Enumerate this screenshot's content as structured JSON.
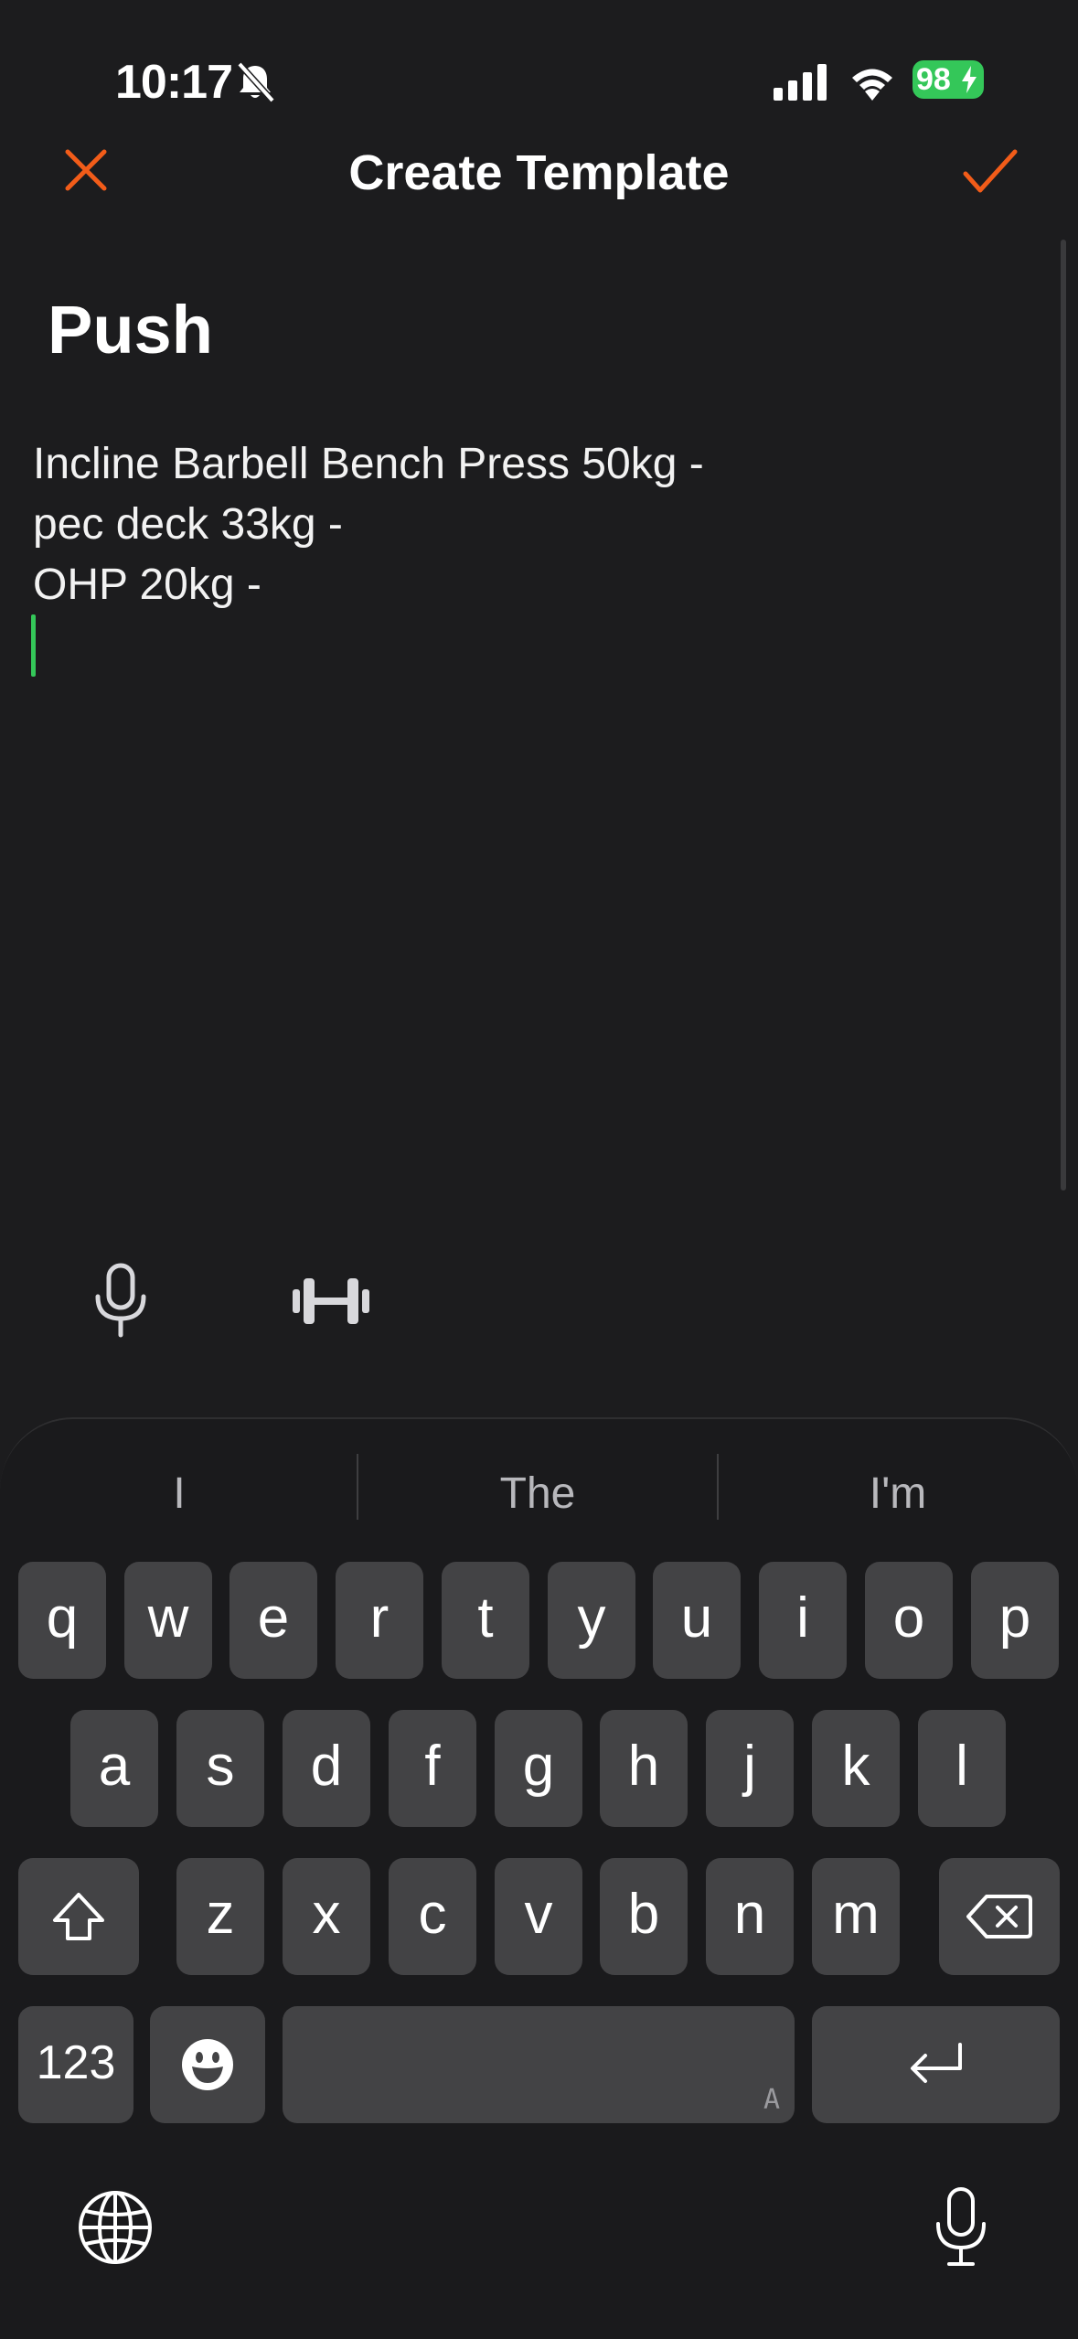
{
  "status_bar": {
    "time": "10:17",
    "battery": "98"
  },
  "nav": {
    "title": "Create Template"
  },
  "template": {
    "name": "Push",
    "lines": [
      "Incline Barbell Bench Press 50kg -",
      "pec deck 33kg -",
      "OHP 20kg -"
    ]
  },
  "keyboard": {
    "suggestions": [
      "I",
      "The",
      "I'm"
    ],
    "row1": [
      "q",
      "w",
      "e",
      "r",
      "t",
      "y",
      "u",
      "i",
      "o",
      "p"
    ],
    "row2": [
      "a",
      "s",
      "d",
      "f",
      "g",
      "h",
      "j",
      "k",
      "l"
    ],
    "row3": [
      "z",
      "x",
      "c",
      "v",
      "b",
      "n",
      "m"
    ],
    "numbers_label": "123",
    "space_hint": "A"
  },
  "colors": {
    "accent": "#f25c19",
    "caret": "#34c759",
    "battery": "#34c759",
    "background": "#1c1c1e"
  }
}
